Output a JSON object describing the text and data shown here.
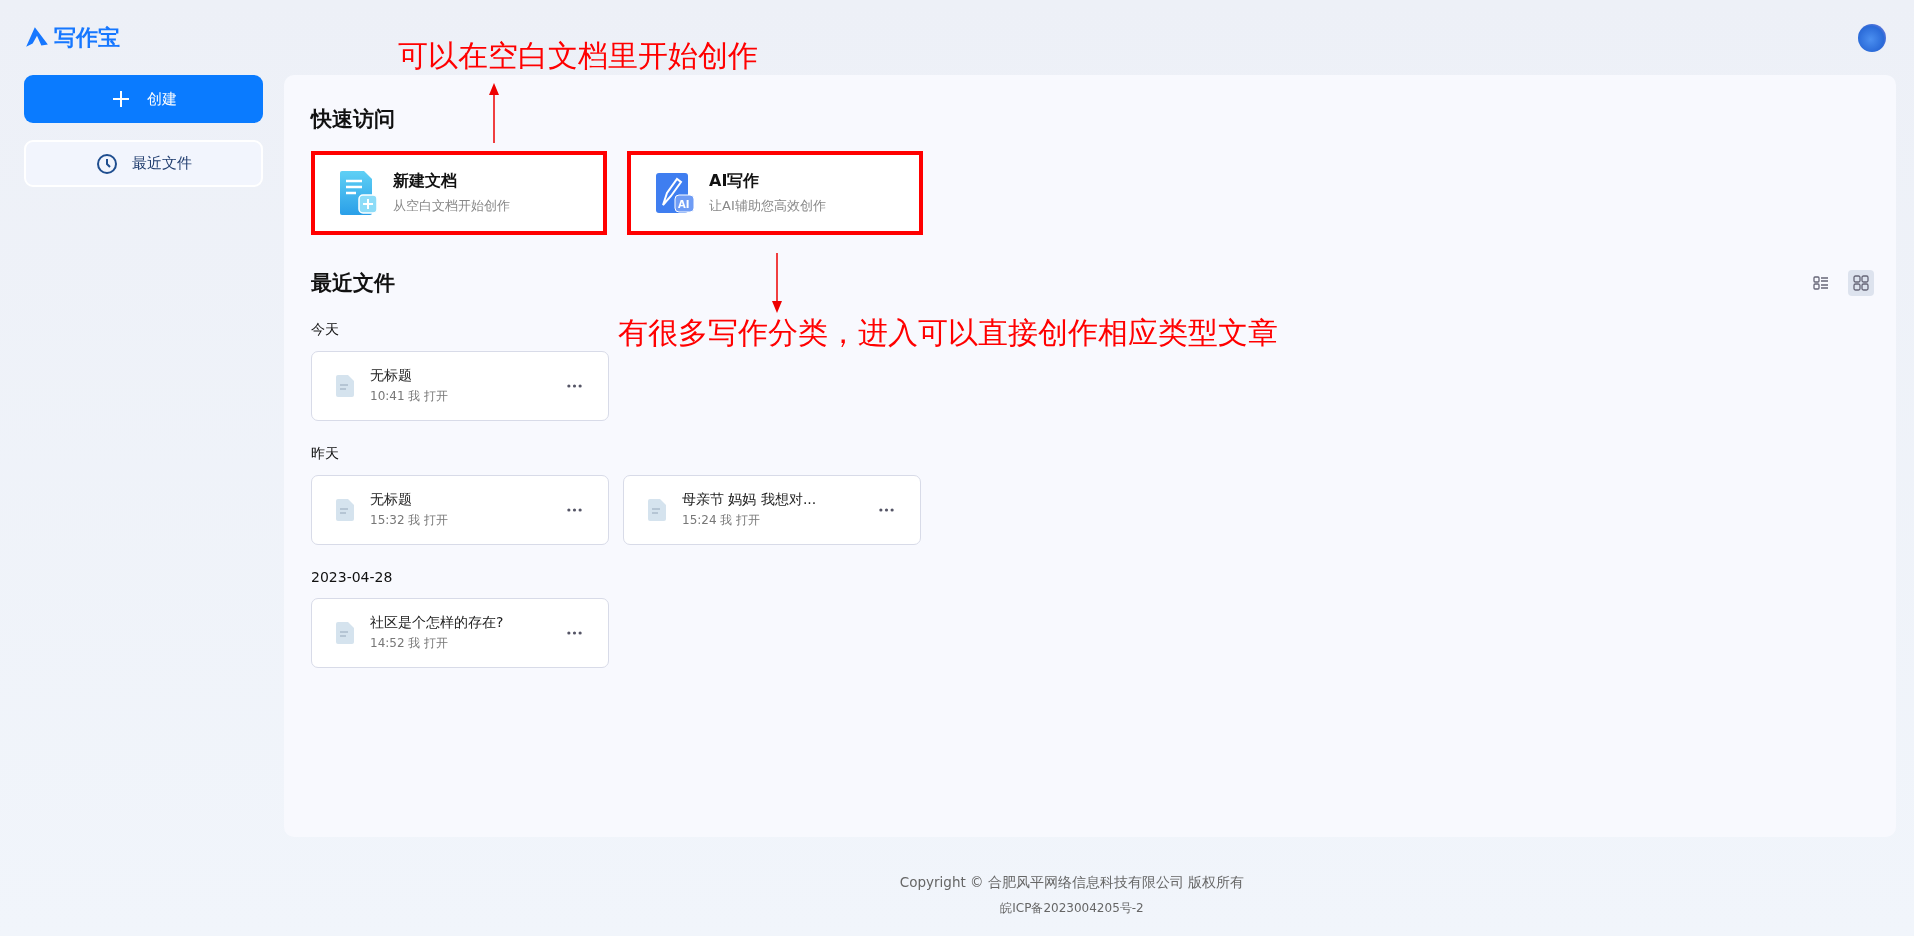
{
  "logo": {
    "text": "写作宝"
  },
  "sidebar": {
    "create_button": "创建",
    "items": [
      {
        "label": "最近文件"
      }
    ]
  },
  "quick_access": {
    "title": "快速访问",
    "cards": [
      {
        "kind": "doc",
        "title": "新建文档",
        "subtitle": "从空白文档开始创作",
        "highlighted": true
      },
      {
        "kind": "ai",
        "icon_label": "AI",
        "title": "AI写作",
        "subtitle": "让AI辅助您高效创作",
        "highlighted": true
      }
    ]
  },
  "recent": {
    "title": "最近文件",
    "view_toggles": [
      {
        "kind": "list",
        "selected": false
      },
      {
        "kind": "grid",
        "selected": true
      }
    ],
    "groups": [
      {
        "label": "今天",
        "files": [
          {
            "title": "无标题",
            "meta": "10:41 我 打开"
          }
        ]
      },
      {
        "label": "昨天",
        "files": [
          {
            "title": "无标题",
            "meta": "15:32 我 打开"
          },
          {
            "title": "母亲节 妈妈 我想对...",
            "meta": "15:24 我 打开"
          }
        ]
      },
      {
        "label": "2023-04-28",
        "files": [
          {
            "title": "社区是个怎样的存在?",
            "meta": "14:52 我 打开"
          }
        ]
      }
    ]
  },
  "annotations": [
    {
      "kind": "up",
      "text": "可以在空白文档里开始创作"
    },
    {
      "kind": "down",
      "text": "有很多写作分类，进入可以直接创作相应类型文章"
    }
  ],
  "footer": {
    "copyright": "Copyright © 合肥风平网络信息科技有限公司 版权所有",
    "icp": "皖ICP备2023004205号-2"
  }
}
